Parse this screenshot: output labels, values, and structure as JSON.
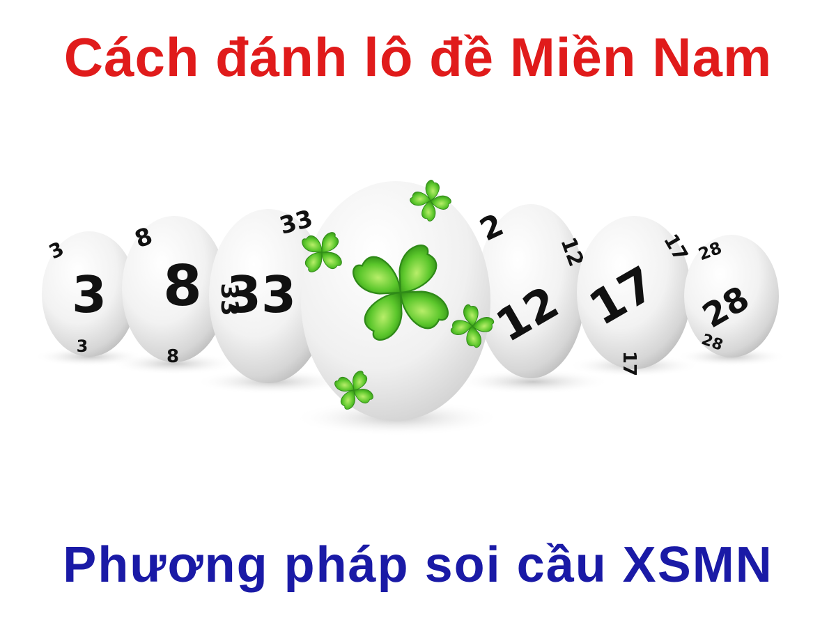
{
  "title": "Cách đánh lô đề Miền Nam",
  "subtitle": "Phương pháp soi cầu XSMN",
  "colors": {
    "title": "#e01b1b",
    "subtitle": "#1a1aa6",
    "clover": "#55c22e"
  },
  "balls": [
    {
      "number": "3",
      "edge_top": "3",
      "edge_bottom": "3"
    },
    {
      "number": "8",
      "edge_top": "8",
      "edge_bottom": "8"
    },
    {
      "number": "33",
      "edge_top": "33",
      "edge_bottom": "33"
    },
    {
      "number": "12",
      "edge_top": "2",
      "edge_side": "12"
    },
    {
      "number": "17",
      "edge_side": "17",
      "edge_bottom": "17"
    },
    {
      "number": "28",
      "edge_top": "28",
      "edge_bottom": "28"
    }
  ],
  "center_ball": {
    "icon": "four-leaf-clover-icon"
  }
}
